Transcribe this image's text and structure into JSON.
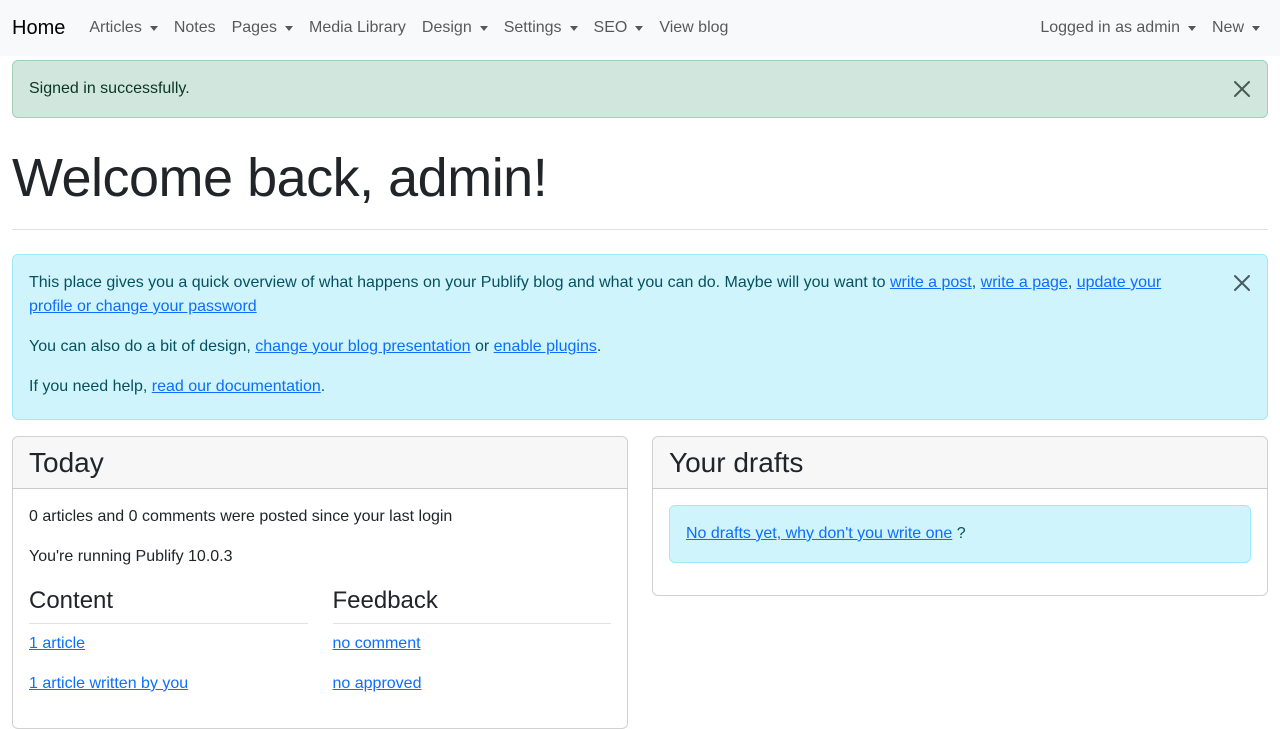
{
  "navbar": {
    "brand": "Home",
    "left_items": [
      {
        "label": "Articles",
        "dropdown": true
      },
      {
        "label": "Notes",
        "dropdown": false
      },
      {
        "label": "Pages",
        "dropdown": true
      },
      {
        "label": "Media Library",
        "dropdown": false
      },
      {
        "label": "Design",
        "dropdown": true
      },
      {
        "label": "Settings",
        "dropdown": true
      },
      {
        "label": "SEO",
        "dropdown": true
      },
      {
        "label": "View blog",
        "dropdown": false
      }
    ],
    "right_items": [
      {
        "label": "Logged in as admin",
        "dropdown": true
      },
      {
        "label": "New",
        "dropdown": true
      }
    ]
  },
  "flash": {
    "message": "Signed in successfully.",
    "close_icon": "close-icon"
  },
  "page": {
    "title": "Welcome back, admin!"
  },
  "info": {
    "p1_text": "This place gives you a quick overview of what happens on your Publify blog and what you can do. Maybe will you want to ",
    "link_write_post": "write a post",
    "sep1": ", ",
    "link_write_page": "write a page",
    "sep2": ", ",
    "link_update_profile": "update your profile or change your password",
    "p2_text": "You can also do a bit of design, ",
    "link_change_presentation": "change your blog presentation",
    "p2_or": " or ",
    "link_enable_plugins": "enable plugins",
    "p2_end": ".",
    "p3_text": "If you need help, ",
    "link_documentation": "read our documentation",
    "p3_end": "."
  },
  "today": {
    "title": "Today",
    "summary": "0 articles and 0 comments were posted since your last login",
    "version": "You're running Publify 10.0.3",
    "content": {
      "heading": "Content",
      "links": [
        "1 article",
        "1 article written by you"
      ]
    },
    "feedback": {
      "heading": "Feedback",
      "links": [
        "no comment",
        "no approved"
      ]
    }
  },
  "drafts": {
    "title": "Your drafts",
    "link": "No drafts yet, why don't you write one",
    "suffix": " ?"
  },
  "colors": {
    "navbar_bg": "#f8f9fa",
    "success_bg": "#d1e7dd",
    "info_bg": "#cff4fc",
    "link": "#0d6efd"
  }
}
